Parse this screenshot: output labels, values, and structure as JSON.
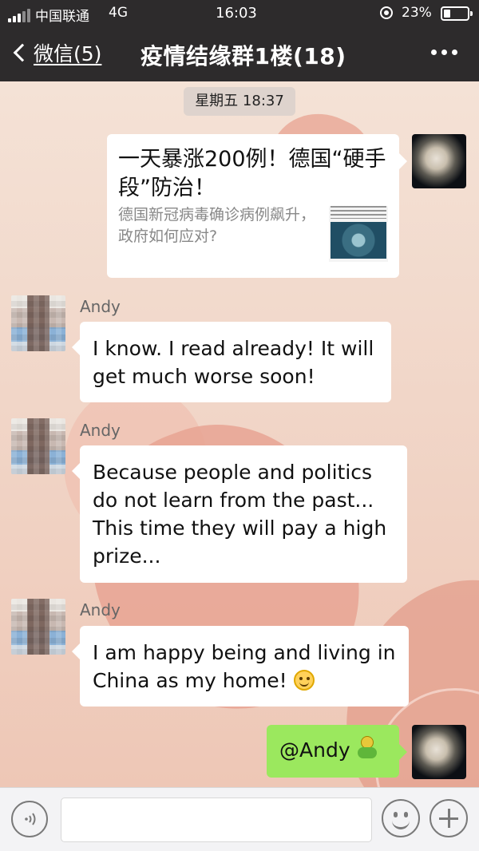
{
  "status_bar": {
    "carrier": "中国联通",
    "network": "4G",
    "time": "16:03",
    "battery": "23%"
  },
  "nav": {
    "back_label": "微信(5)",
    "title": "疫情结缘群1楼(18)"
  },
  "chat": {
    "timestamp": "星期五 18:37",
    "link_card": {
      "title": "一天暴涨200例！德国“硬手段”防治！",
      "description": "德国新冠病毒确诊病例飙升，政府如何应对?"
    },
    "messages": [
      {
        "sender": "Andy",
        "text": "I know. I read already! It will get much worse soon!"
      },
      {
        "sender": "Andy",
        "text": "Because people and politics do not learn from the past... This time they will pay a high prize..."
      },
      {
        "sender": "Andy",
        "text": "I am happy being and living in China as my home!"
      }
    ],
    "mention": "@Andy"
  },
  "colors": {
    "topbar": "#2d2b2c",
    "bubble_out_green": "#9be85e"
  },
  "icons": [
    "signal-icon",
    "lock-rotation-icon",
    "battery-icon",
    "back-chevron-icon",
    "more-icon",
    "voice-icon",
    "emoji-icon",
    "plus-icon",
    "smile-emoji-icon",
    "wechat-emoji-icon"
  ]
}
